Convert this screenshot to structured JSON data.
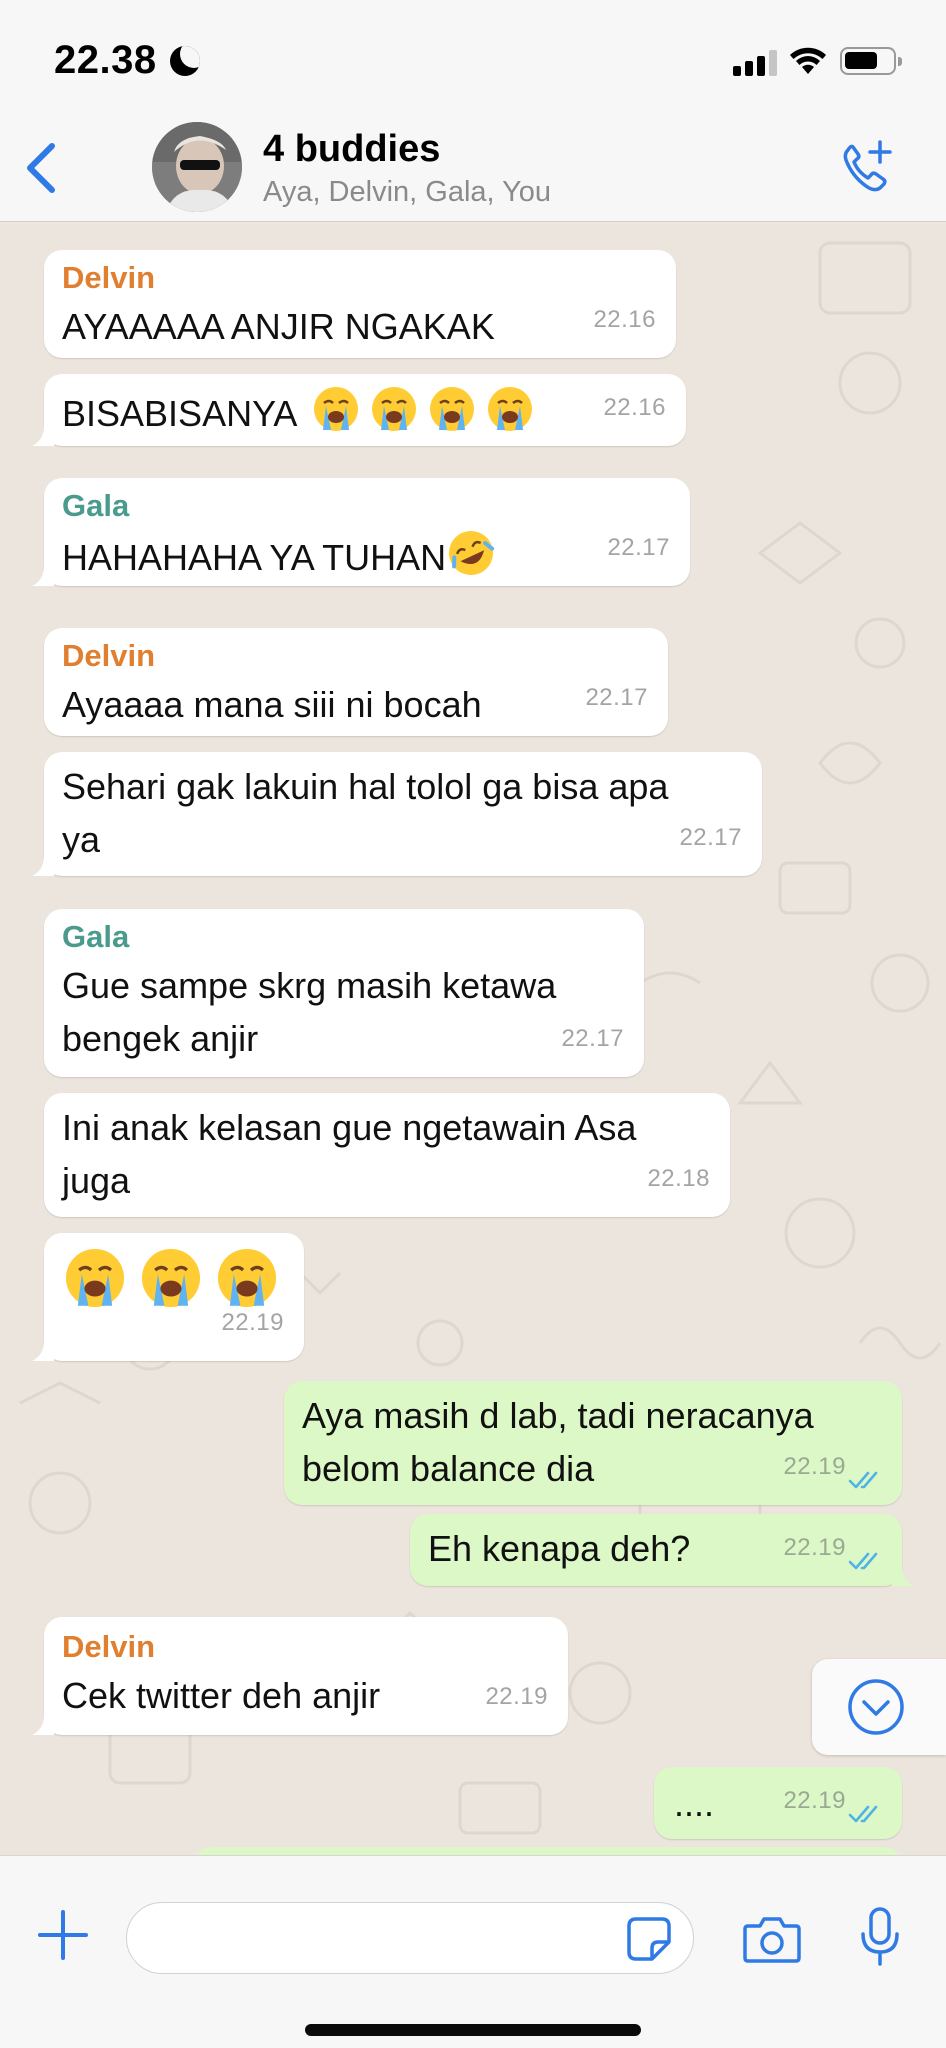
{
  "status_bar": {
    "time": "22.38"
  },
  "header": {
    "title": "4 buddies",
    "members": "Aya, Delvin, Gala, You"
  },
  "messages": [
    {
      "sender": "Delvin",
      "text": "AYAAAAA ANJIR NGAKAK",
      "time": "22.16"
    },
    {
      "text": "BISABISANYA",
      "time": "22.16"
    },
    {
      "sender": "Gala",
      "text": "HAHAHAHA YA TUHAN",
      "time": "22.17"
    },
    {
      "sender": "Delvin",
      "text": "Ayaaaa mana siii ni bocah",
      "time": "22.17"
    },
    {
      "text": "Sehari gak lakuin hal tolol ga bisa apa ya",
      "time": "22.17"
    },
    {
      "sender": "Gala",
      "text": "Gue sampe skrg masih ketawa bengek anjir",
      "time": "22.17"
    },
    {
      "text": "Ini anak kelasan gue ngetawain Asa juga",
      "time": "22.18"
    },
    {
      "text": "",
      "time": "22.19"
    },
    {
      "text": "Aya masih d lab, tadi neracanya belom balance dia",
      "time": "22.19",
      "outgoing": true
    },
    {
      "text": "Eh kenapa deh?",
      "time": "22.19",
      "outgoing": true
    },
    {
      "sender": "Delvin",
      "text": "Cek twitter deh anjir",
      "time": "22.19"
    },
    {
      "text": "....",
      "time": "22.19",
      "outgoing": true
    }
  ],
  "input": {
    "placeholder": "",
    "value": ""
  },
  "colors": {
    "accent": "#2f7ae5",
    "sender_orange": "#e07f30",
    "sender_teal": "#4a9a8e",
    "outgoing_bubble": "#dcf8c6",
    "incoming_bubble": "#ffffff",
    "read_ticks": "#4fb3e8"
  },
  "icons": [
    "back-icon",
    "call-add-icon",
    "scroll-down-icon",
    "plus-icon",
    "sticker-icon",
    "camera-icon",
    "microphone-icon",
    "double-check-icon",
    "loudly-crying-face-emoji",
    "rofl-emoji"
  ]
}
